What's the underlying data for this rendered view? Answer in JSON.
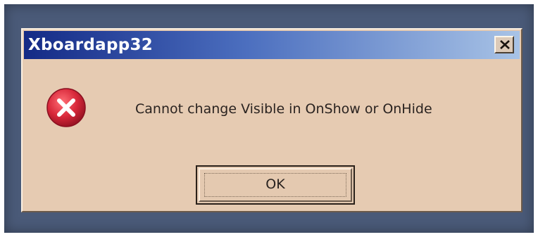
{
  "window": {
    "title": "Xboardapp32"
  },
  "titlebar": {
    "close_icon": "close-x-icon"
  },
  "message": {
    "icon": "error-icon",
    "text": "Cannot change Visible in OnShow or OnHide"
  },
  "buttons": {
    "ok_label": "OK"
  },
  "colors": {
    "titlebar_start": "#142a86",
    "titlebar_end": "#a8c3e6",
    "dialog_face": "#e6cbb2",
    "error_red": "#d8283a"
  }
}
